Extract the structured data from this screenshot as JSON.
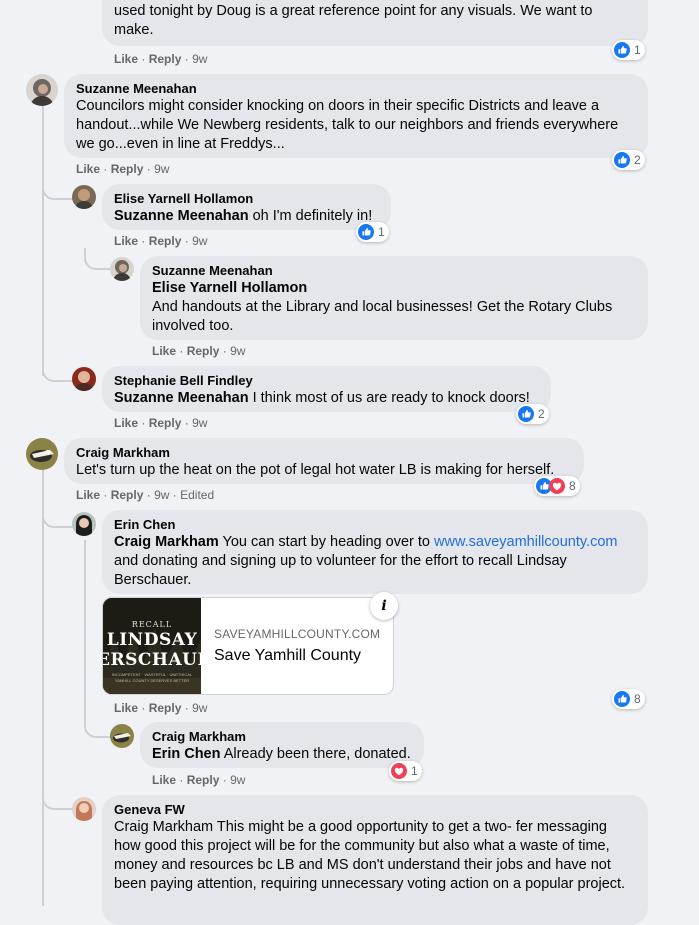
{
  "colors": {
    "page_bg": "#f0f2f5",
    "bubble": "#e4e6eb",
    "link": "#216fdb",
    "like_blue": "#1877f2",
    "love_red": "#f33e58",
    "meta_grey": "#65676b"
  },
  "action_labels": {
    "like": "Like",
    "reply": "Reply",
    "separator": "·"
  },
  "comments": [
    {
      "id": "c0",
      "text_lines": [
        "used tonight by Doug is a great reference point for any visuals. We want to",
        "make."
      ],
      "time": "9w",
      "reactions": {
        "icons": [
          "like-icon"
        ],
        "count": "1"
      }
    },
    {
      "id": "c1",
      "author": "Suzanne Meenahan",
      "text": "Councilors might consider knocking on doors in their specific Districts and leave a handout...while We Newberg residents, talk to our neighbors and friends everywhere we go...even in line at Freddys...",
      "time": "9w",
      "reactions": {
        "icons": [
          "like-icon"
        ],
        "count": "2"
      }
    },
    {
      "id": "c2",
      "author": "Elise Yarnell Hollamon",
      "mention": "Suzanne Meenahan",
      "text": " oh I'm definitely in!",
      "time": "9w",
      "reactions": {
        "icons": [
          "like-icon"
        ],
        "count": "1"
      }
    },
    {
      "id": "c3",
      "author": "Suzanne Meenahan",
      "mention": "Elise Yarnell Hollamon",
      "text": "And handouts at the Library and local businesses! Get the Rotary Clubs involved too.",
      "time": "9w"
    },
    {
      "id": "c4",
      "author": "Stephanie Bell Findley",
      "mention": "Suzanne Meenahan",
      "text": " I think most of us are ready to knock doors!",
      "time": "9w",
      "reactions": {
        "icons": [
          "like-icon"
        ],
        "count": "2"
      }
    },
    {
      "id": "c5",
      "author": "Craig Markham",
      "text": "Let's turn up the heat on the pot of legal hot water LB is making for herself.",
      "time": "9w",
      "edited": "Edited",
      "reactions": {
        "icons": [
          "like-icon",
          "love-icon"
        ],
        "count": "8"
      }
    },
    {
      "id": "c6",
      "author": "Erin Chen",
      "mention": "Craig Markham",
      "text_a": " You can start by heading over to ",
      "link": "www.saveyamhillcounty.com",
      "text_b": " and donating and signing up to volunteer for the effort to recall Lindsay Berschauer.",
      "time": "9w",
      "reactions": {
        "icons": [
          "like-icon"
        ],
        "count": "8"
      },
      "link_card": {
        "thumb_top": "RECALL",
        "thumb_name1": "LINDSAY",
        "thumb_name2": "ERSCHAUE",
        "thumb_small": "INCOMPETENT · WASTEFUL · UNETHICAL",
        "thumb_small2": "YAMHILL COUNTY DESERVES BETTER",
        "domain": "SAVEYAMHILLCOUNTY.COM",
        "title": "Save Yamhill County",
        "info_glyph": "i"
      }
    },
    {
      "id": "c7",
      "author": "Craig Markham",
      "mention": "Erin Chen",
      "text": " Already been there, donated.",
      "time": "9w",
      "reactions": {
        "icons": [
          "love-icon"
        ],
        "count": "1"
      }
    },
    {
      "id": "c8",
      "author": "Geneva FW",
      "text": "Craig Markham This might be a good opportunity to get a two- fer messaging how good this project will be for the community but also what a waste of time, money and resources bc LB and MS don't understand their jobs and have not been paying attention, requiring unnecessary voting action on a popular project."
    }
  ]
}
